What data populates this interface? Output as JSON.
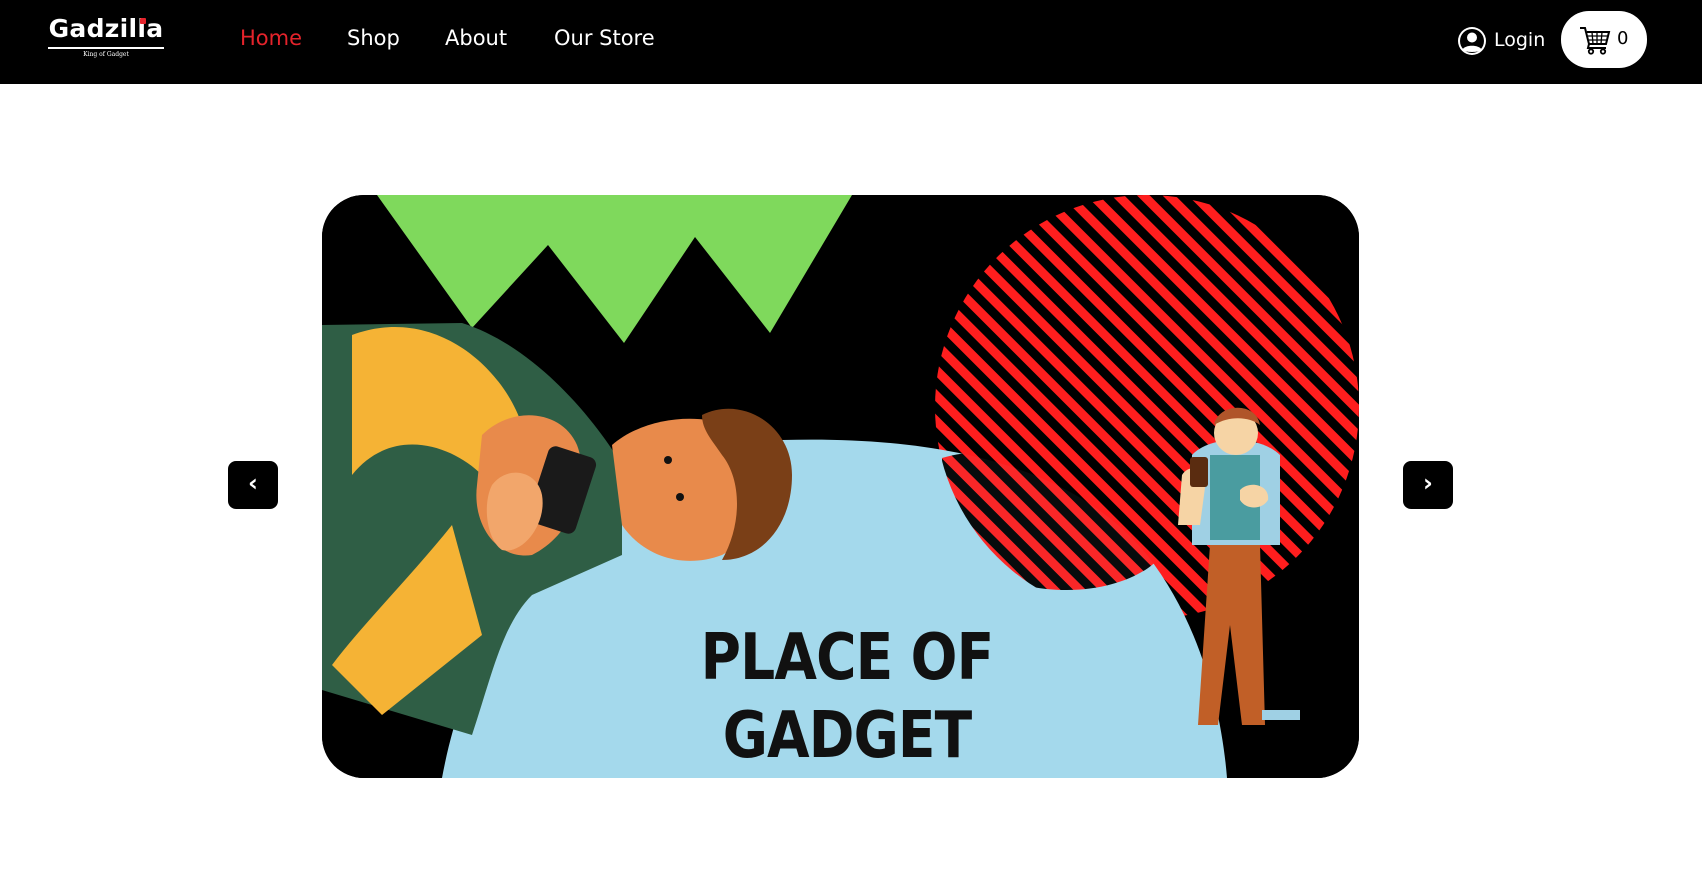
{
  "brand": {
    "name": "Gadzilla",
    "tagline": "King of Gadget"
  },
  "nav": {
    "items": [
      {
        "label": "Home",
        "active": true
      },
      {
        "label": "Shop",
        "active": false
      },
      {
        "label": "About",
        "active": false
      },
      {
        "label": "Our Store",
        "active": false
      }
    ]
  },
  "account": {
    "login_label": "Login",
    "icon": "user-circle-icon"
  },
  "cart": {
    "count": "0",
    "icon": "shopping-cart-icon"
  },
  "carousel": {
    "prev_label": "‹",
    "next_label": "›",
    "slide": {
      "headline_line1": "PLACE OF",
      "headline_line2": "GADGET"
    }
  },
  "colors": {
    "nav_background": "#000000",
    "active_link": "#e4232b",
    "slide_background": "#000000",
    "green_zigzag": "#7fd95c",
    "blue_blob": "#a4d9ec",
    "red_stripes": "#ff1e1e"
  }
}
